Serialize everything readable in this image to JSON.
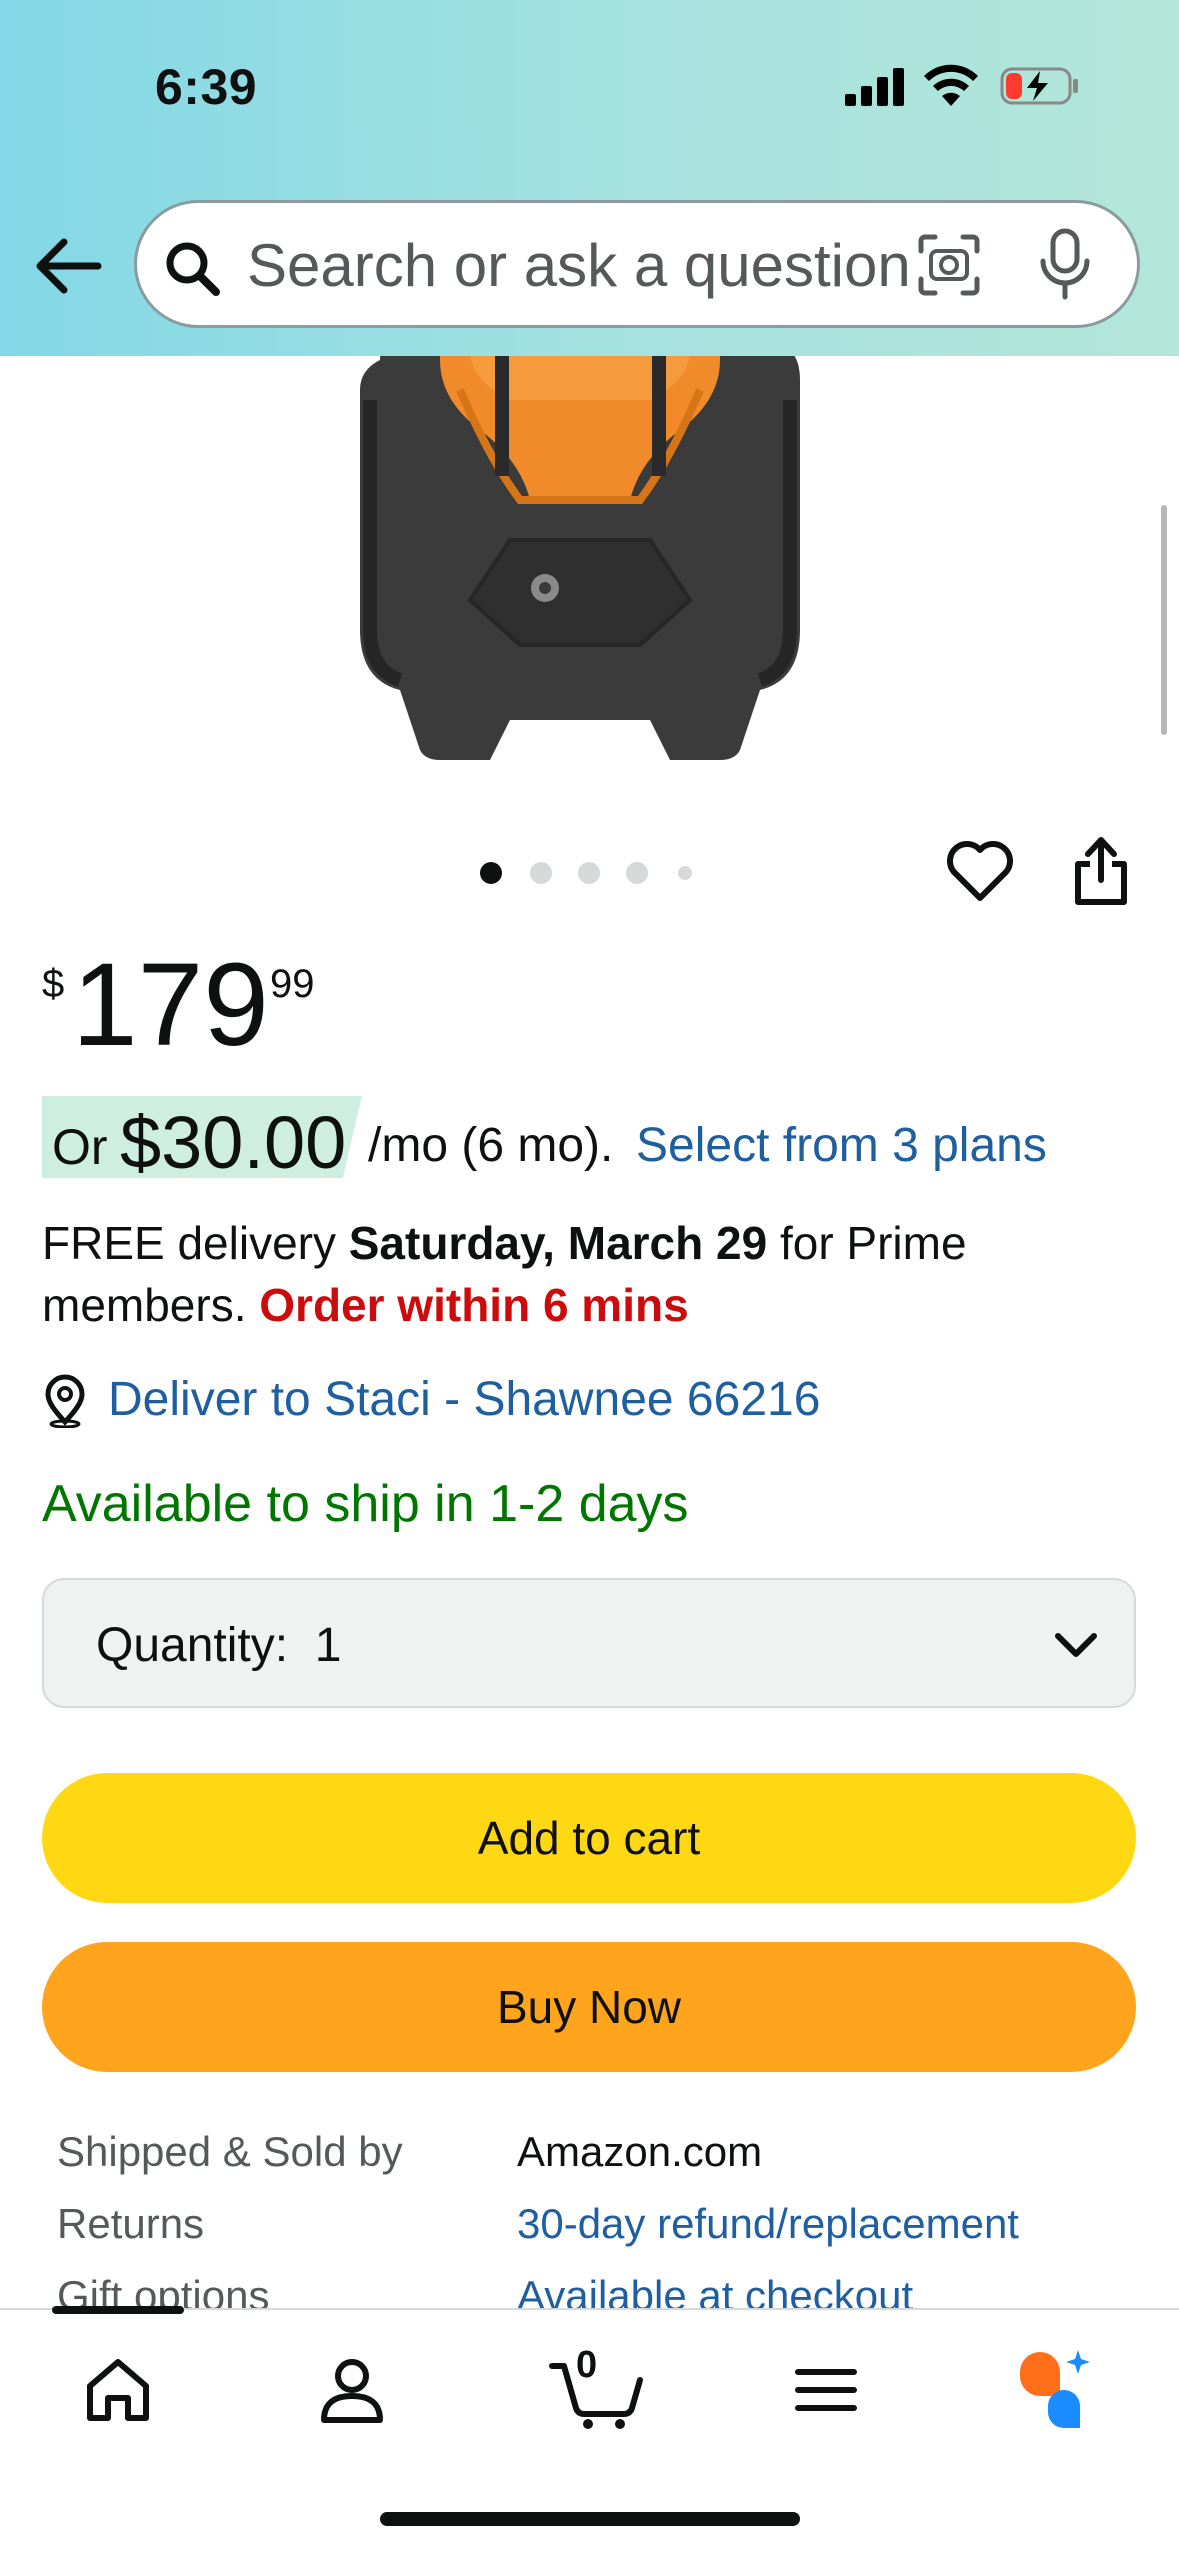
{
  "status_bar": {
    "time": "6:39"
  },
  "search": {
    "placeholder": "Search or ask a question"
  },
  "carousel": {
    "total_images": 5,
    "active_index": 0
  },
  "price": {
    "symbol": "$",
    "whole": "179",
    "fraction": "99"
  },
  "monthly": {
    "or": "Or",
    "amount": "$30.00",
    "term": "/mo (6 mo).",
    "link": "Select from 3 plans"
  },
  "delivery": {
    "prefix": "FREE delivery ",
    "date": "Saturday, March 29",
    "suffix": " for Prime members. ",
    "urgency": "Order within 6 mins"
  },
  "deliver_to": "Deliver to Staci - Shawnee 66216",
  "availability": "Available to ship in 1-2 days",
  "quantity": {
    "label": "Quantity:",
    "value": "1"
  },
  "buttons": {
    "add_to_cart": "Add to cart",
    "buy_now": "Buy Now"
  },
  "info": [
    {
      "label": "Shipped & Sold by",
      "value": "Amazon.com",
      "is_link": false
    },
    {
      "label": "Returns",
      "value": "30-day refund/replacement",
      "is_link": true
    },
    {
      "label": "Gift options",
      "value": "Available at checkout",
      "is_link": true
    }
  ],
  "bottom_nav": {
    "cart_count": "0",
    "items": [
      "home-icon",
      "account-icon",
      "cart-icon",
      "menu-icon",
      "rufus-ai-icon"
    ]
  },
  "colors": {
    "header_gradient_start": "#82d8e6",
    "header_gradient_end": "#b3e6d8",
    "add_to_cart": "#ffd814",
    "buy_now": "#ffa41c",
    "link": "#1f5fa0",
    "urgent": "#cc0c0c",
    "available": "#007600",
    "monthly_highlight": "#cfeee2"
  }
}
